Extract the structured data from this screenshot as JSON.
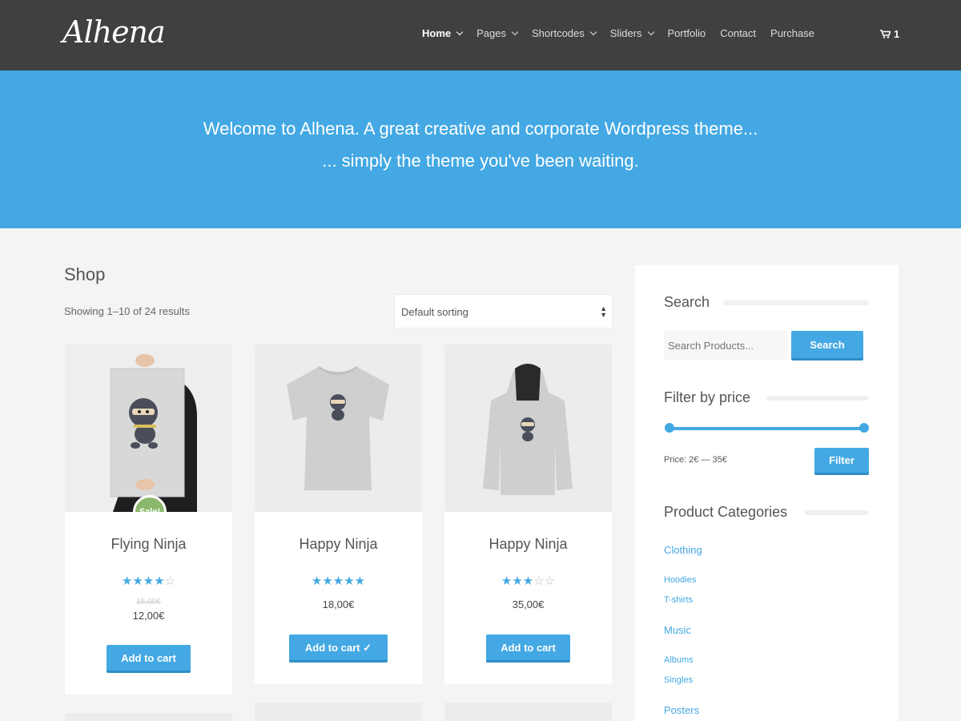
{
  "header": {
    "logo": "Alhena",
    "nav": [
      {
        "label": "Home",
        "dropdown": true,
        "active": true
      },
      {
        "label": "Pages",
        "dropdown": true
      },
      {
        "label": "Shortcodes",
        "dropdown": true
      },
      {
        "label": "Sliders",
        "dropdown": true
      },
      {
        "label": "Portfolio"
      },
      {
        "label": "Contact"
      },
      {
        "label": "Purchase"
      }
    ],
    "cart_count": "1"
  },
  "hero": {
    "line1": "Welcome to Alhena. A great creative and corporate Wordpress theme...",
    "line2": "... simply the theme you've been waiting."
  },
  "shop": {
    "title": "Shop",
    "result_count": "Showing 1–10 of 24 results",
    "sort_value": "Default sorting",
    "products": [
      {
        "name": "Flying Ninja",
        "rating": 4,
        "old_price": "15,00€",
        "price": "12,00€",
        "button": "Add to cart",
        "badge": "Sale!"
      },
      {
        "name": "Happy Ninja",
        "rating": 5,
        "price": "18,00€",
        "button": "Add to cart"
      },
      {
        "name": "Happy Ninja",
        "rating": 3,
        "price": "35,00€",
        "button": "Add to cart"
      }
    ]
  },
  "sidebar": {
    "search_title": "Search",
    "search_placeholder": "Search Products...",
    "search_button": "Search",
    "filter_title": "Filter by price",
    "price_label": "Price: 2€ — 35€",
    "filter_button": "Filter",
    "categories_title": "Product Categories",
    "categories": [
      "Clothing",
      "Hoodies",
      "T-shirts",
      "Music",
      "Albums",
      "Singles",
      "Posters"
    ]
  },
  "colors": {
    "accent": "#43a8e3",
    "header_bg": "#404040",
    "sale": "#8bb86c"
  }
}
